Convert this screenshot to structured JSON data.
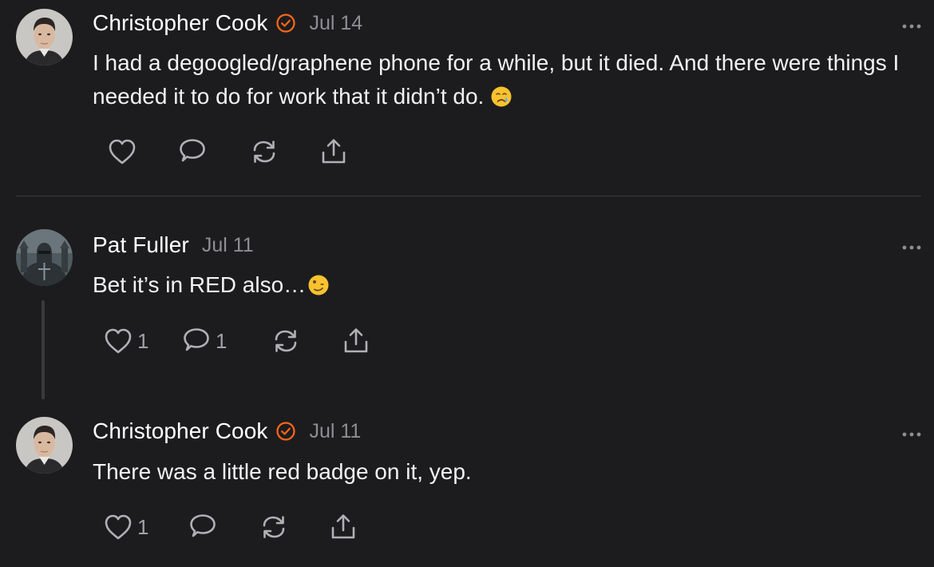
{
  "comments": [
    {
      "author": "Christopher Cook",
      "verified": true,
      "date": "Jul 14",
      "text": "I had a degoogled/graphene phone for a while, but it died. And there were things I needed it to do for work that it didn’t do.",
      "emoji": "crying-face",
      "likes": "",
      "replies": "",
      "avatar": "christopher-cook-avatar"
    },
    {
      "author": "Pat Fuller",
      "verified": false,
      "date": "Jul 11",
      "text": "Bet it’s in RED also…",
      "emoji": "face-with-uneven-eyes",
      "likes": "1",
      "replies": "1",
      "avatar": "pat-fuller-avatar"
    },
    {
      "author": "Christopher Cook",
      "verified": true,
      "date": "Jul 11",
      "text": "There was a little red badge on it, yep.",
      "emoji": "",
      "likes": "1",
      "replies": "",
      "avatar": "christopher-cook-avatar"
    }
  ],
  "icons": {
    "like": "heart-icon",
    "reply": "speech-bubble-icon",
    "restack": "restack-icon",
    "share": "share-icon",
    "more": "more-dots-icon",
    "verified": "verified-check-icon"
  },
  "colors": {
    "background": "#1c1c1e",
    "text": "#ffffff",
    "muted": "#8e8e93",
    "icon": "#b0b0b5",
    "accent": "#ff6719",
    "divider": "#3a3a3c"
  }
}
